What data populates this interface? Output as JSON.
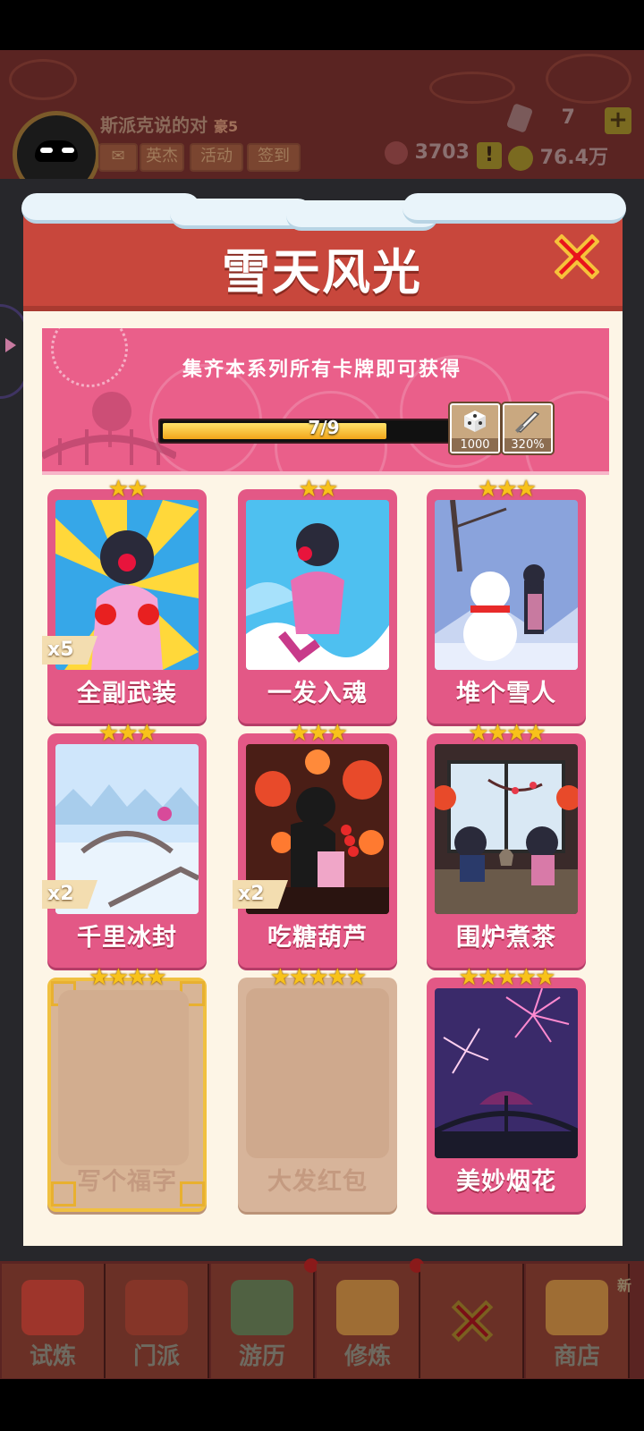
{
  "user": {
    "name": "斯派克说的对",
    "level": "豪5"
  },
  "top_buttons": {
    "mail": "",
    "hero": "英杰",
    "activity": "活动",
    "signin": "签到"
  },
  "resources": {
    "gems": "7",
    "tickets": "3703",
    "coins": "76.4万"
  },
  "dialog": {
    "title": "雪天风光",
    "banner_text": "集齐本系列所有卡牌即可获得",
    "progress": {
      "label": "7/9",
      "current": 7,
      "total": 9
    },
    "rewards": [
      {
        "icon": "dice-icon",
        "value": "1000"
      },
      {
        "icon": "sword-icon",
        "value": "320%"
      }
    ],
    "cards": [
      {
        "name": "全副武装",
        "stars": 2,
        "count": "x5",
        "owned": true,
        "theme": "sunburst"
      },
      {
        "name": "一发入魂",
        "stars": 2,
        "count": "",
        "owned": true,
        "theme": "ice"
      },
      {
        "name": "堆个雪人",
        "stars": 3,
        "count": "",
        "owned": true,
        "theme": "snowman"
      },
      {
        "name": "千里冰封",
        "stars": 3,
        "count": "x2",
        "owned": true,
        "theme": "bridge"
      },
      {
        "name": "吃糖葫芦",
        "stars": 3,
        "count": "x2",
        "owned": true,
        "theme": "lanterns"
      },
      {
        "name": "围炉煮茶",
        "stars": 4,
        "count": "",
        "owned": true,
        "theme": "tea"
      },
      {
        "name": "写个福字",
        "stars": 4,
        "count": "",
        "owned": false,
        "theme": "gold"
      },
      {
        "name": "大发红包",
        "stars": 5,
        "count": "",
        "owned": false,
        "theme": "locked"
      },
      {
        "name": "美妙烟花",
        "stars": 5,
        "count": "",
        "owned": true,
        "theme": "fireworks"
      }
    ]
  },
  "bottom_nav": [
    {
      "label": "试炼"
    },
    {
      "label": "门派"
    },
    {
      "label": "游历"
    },
    {
      "label": "修炼"
    },
    {
      "label": ""
    },
    {
      "label": "商店",
      "tag": "新"
    }
  ],
  "colors": {
    "header": "#c8473c",
    "card": "#e35886",
    "banner": "#ea5f8a",
    "panel": "#fdf5e6"
  }
}
